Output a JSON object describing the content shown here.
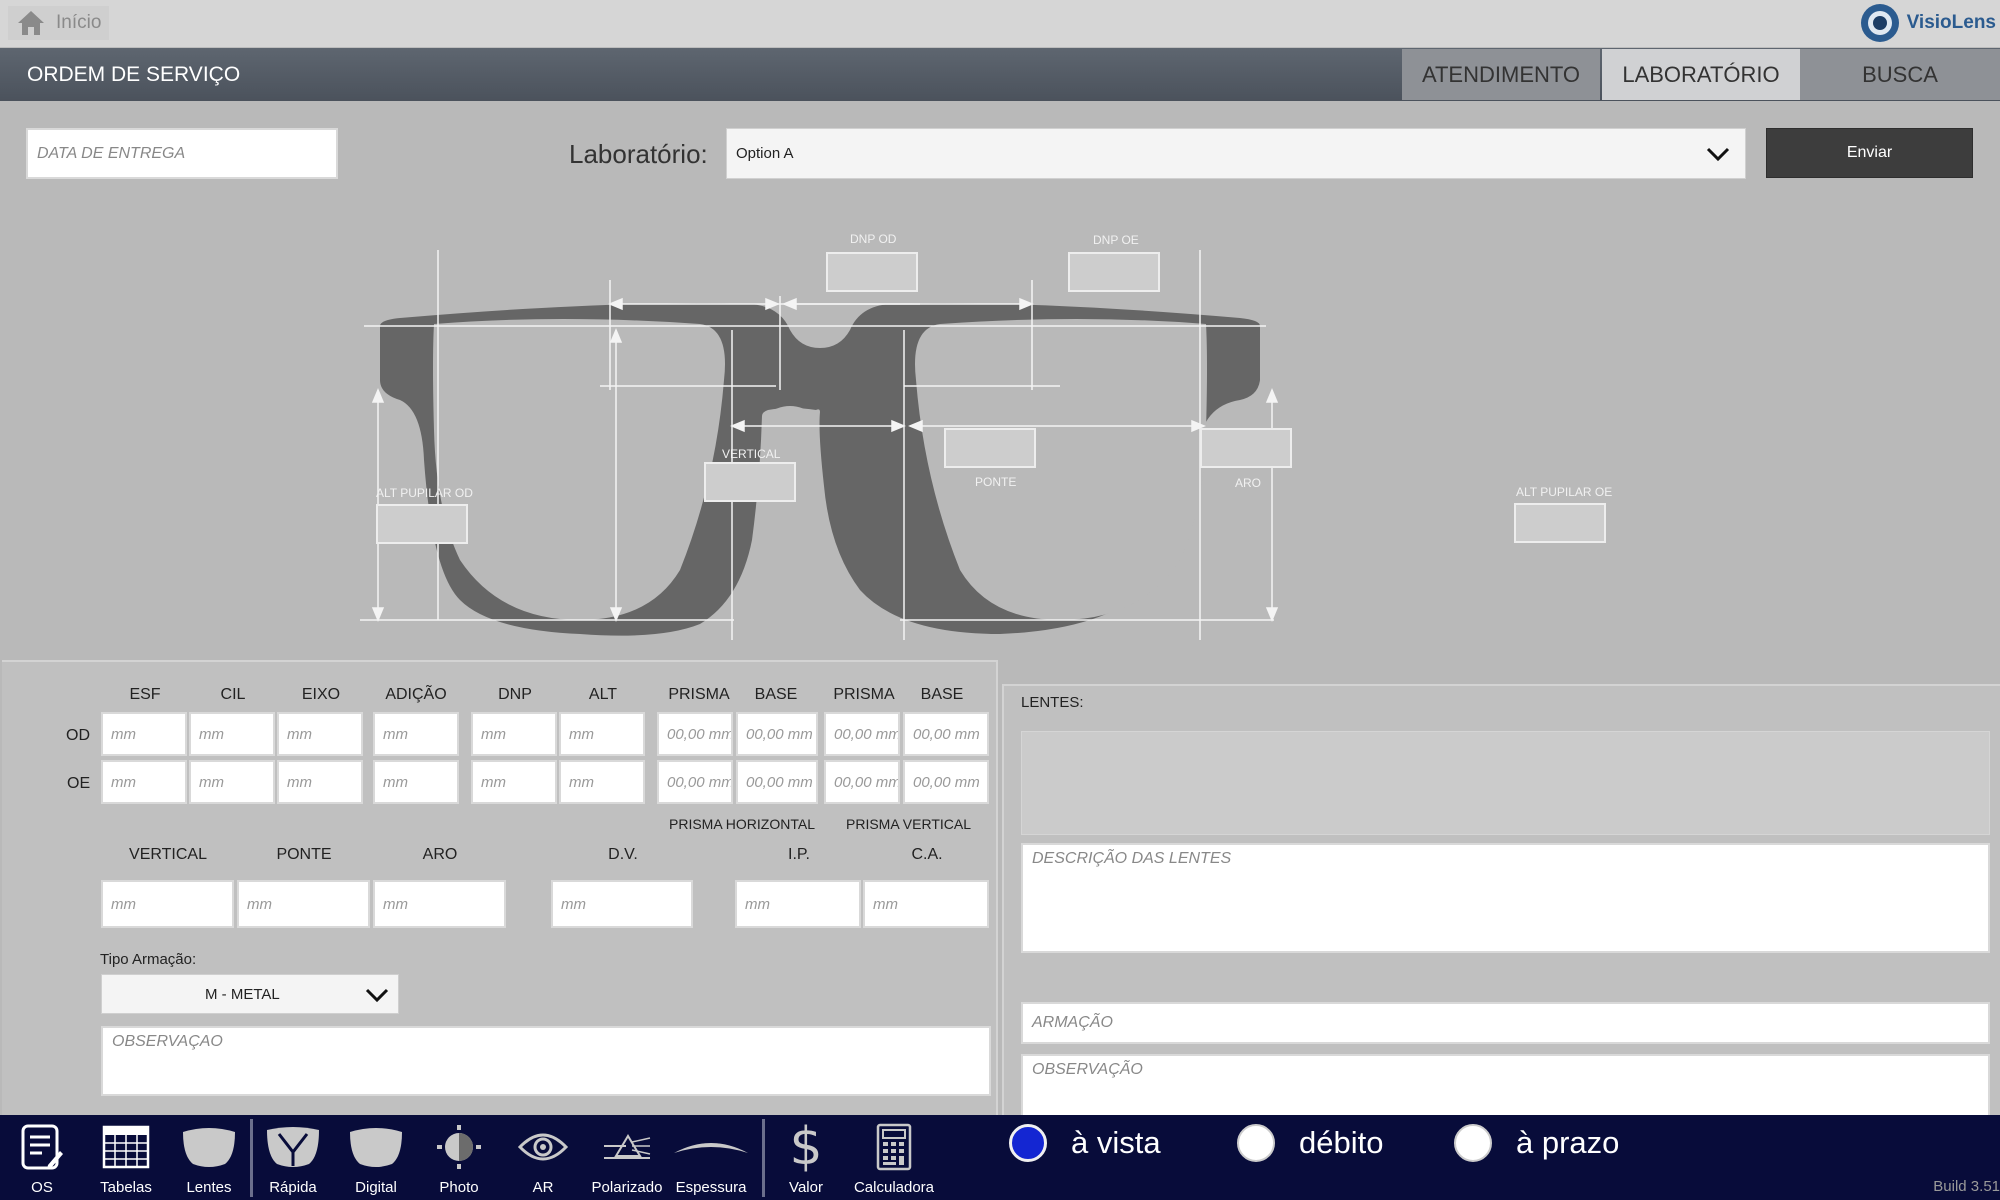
{
  "topbar": {
    "home_label": "Início",
    "brand": "VisioLens"
  },
  "header": {
    "title": "ORDEM DE SERVIÇO",
    "tabs": [
      {
        "label": "ATENDIMENTO"
      },
      {
        "label": "LABORATÓRIO"
      },
      {
        "label": "BUSCA"
      }
    ]
  },
  "order": {
    "delivery_placeholder": "DATA DE ENTREGA",
    "lab_label": "Laboratório:",
    "lab_value": "Option A",
    "send_label": "Enviar"
  },
  "diagram": {
    "dnp_od": "DNP OD",
    "dnp_oe": "DNP OE",
    "vertical": "VERTICAL",
    "ponte": "PONTE",
    "aro": "ARO",
    "alt_od": "ALT PUPILAR OD",
    "alt_oe": "ALT PUPILAR OE"
  },
  "prescription": {
    "headers": [
      "ESF",
      "CIL",
      "EIXO",
      "ADIÇÃO",
      "DNP",
      "ALT",
      "PRISMA",
      "BASE",
      "PRISMA",
      "BASE"
    ],
    "rows": [
      "OD",
      "OE"
    ],
    "mm_placeholder": "mm",
    "prism_placeholder": "00,00 mm",
    "prisma_horizontal": "PRISMA HORIZONTAL",
    "prisma_vertical": "PRISMA VERTICAL",
    "measure_headers": [
      "VERTICAL",
      "PONTE",
      "ARO",
      "D.V.",
      "I.P.",
      "C.A."
    ],
    "frame_type_label": "Tipo Armação:",
    "frame_type_value": "M - METAL",
    "obs_placeholder": "OBSERVAÇAO"
  },
  "lenses": {
    "label": "LENTES:",
    "description_placeholder": "DESCRIÇÃO DAS LENTES",
    "frame_placeholder": "ARMAÇÃO",
    "obs_placeholder": "OBSERVAÇÃO"
  },
  "toolbar": {
    "items": [
      "OS",
      "Tabelas",
      "Lentes",
      "Rápida",
      "Digital",
      "Photo",
      "AR",
      "Polarizado",
      "Espessura",
      "Valor",
      "Calculadora"
    ]
  },
  "payment": {
    "options": [
      "à vista",
      "débito",
      "à prazo"
    ],
    "selected": "à vista"
  },
  "build": "Build 3.51",
  "colors": {
    "accent": "#1426d2",
    "toolbar_bg": "#080c3a",
    "header_bg": "#555c66"
  }
}
